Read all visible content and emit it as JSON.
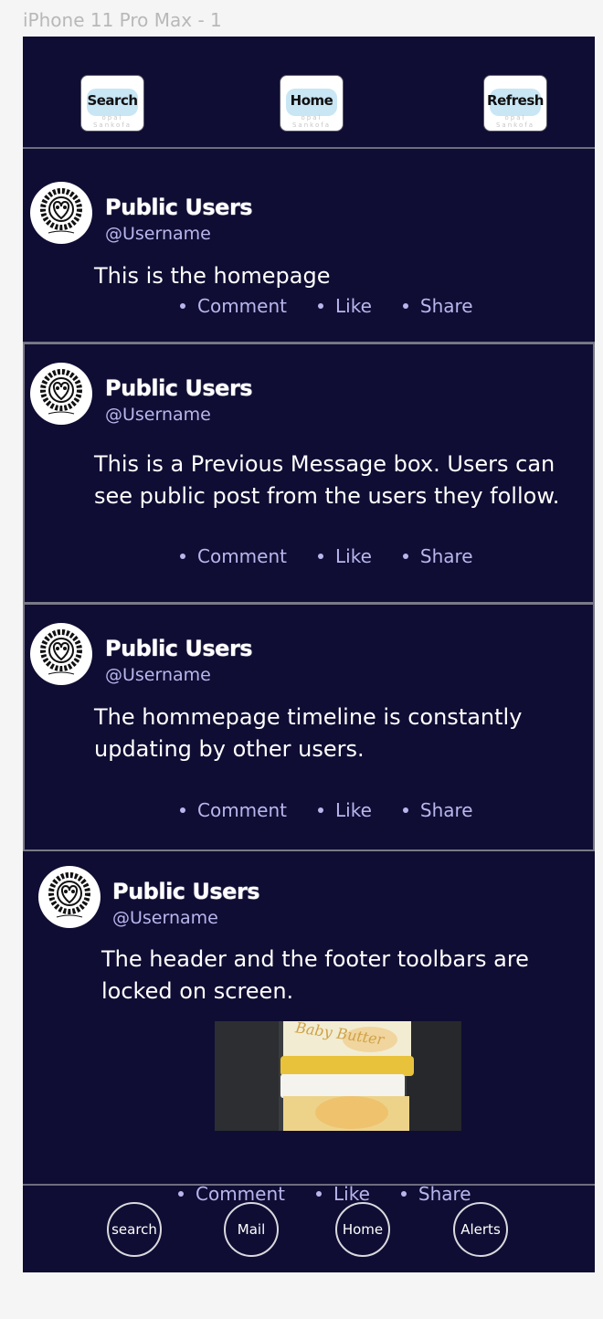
{
  "frame_label": "iPhone 11 Pro Max - 1",
  "header": {
    "buttons": [
      {
        "label": "Search",
        "sub": "opal Sankofa"
      },
      {
        "label": "Home",
        "sub": "opal Sankofa"
      },
      {
        "label": "Refresh",
        "sub": "opal Sankofa"
      }
    ]
  },
  "posts": [
    {
      "name": "Public Users",
      "handle": "@Username",
      "text": "This is the homepage",
      "actions": [
        "Comment",
        "Like",
        "Share"
      ]
    },
    {
      "name": "Public Users",
      "handle": "@Username",
      "text": "This is a Previous Message box. Users can see public post from the users they follow.",
      "actions": [
        "Comment",
        "Like",
        "Share"
      ]
    },
    {
      "name": "Public Users",
      "handle": "@Username",
      "text": "The hommepage timeline is constantly updating by other users.",
      "actions": [
        "Comment",
        "Like",
        "Share"
      ]
    },
    {
      "name": "Public Users",
      "handle": "@Username",
      "text": "The header and the footer toolbars are locked on screen.",
      "image_text": "Baby Butter",
      "actions": [
        "Comment",
        "Like",
        "Share"
      ]
    }
  ],
  "footer": {
    "buttons": [
      "search",
      "Mail",
      "Home",
      "Alerts"
    ]
  },
  "colors": {
    "background": "#0f0d33",
    "accent_text": "#b9b6ee",
    "divider": "#6d6d80"
  }
}
